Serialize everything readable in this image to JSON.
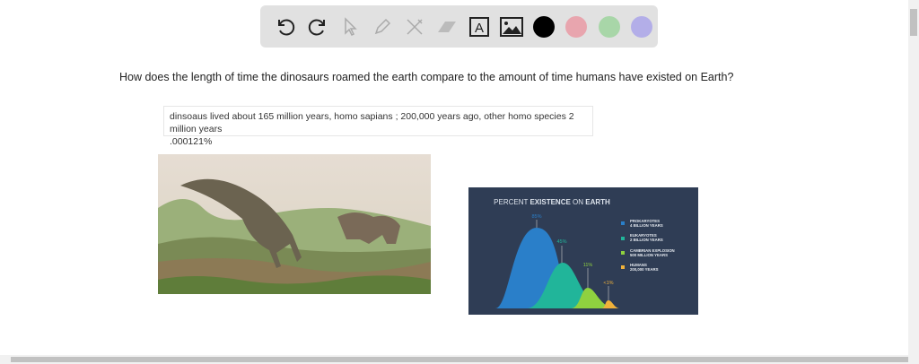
{
  "toolbar": {
    "tools": [
      "undo-icon",
      "redo-icon",
      "select-icon",
      "pen-icon",
      "tools-icon",
      "eraser-icon",
      "text-icon",
      "image-icon"
    ],
    "colors": [
      "#000000",
      "#e8a5ae",
      "#a8d6a8",
      "#b3aee8"
    ]
  },
  "question": "How does the length of time the dinosaurs roamed the earth compare to the amount of time humans have existed on Earth?",
  "answer": {
    "line1": "dinsoaus lived about 165 million years, homo sapians ; 200,000 years ago, other homo species 2 million years",
    "line2": ".000121%"
  },
  "infographic": {
    "title_a": "PERCENT ",
    "title_b": "EXISTENCE",
    "title_c": " ON ",
    "title_d": "EARTH",
    "peaks": [
      {
        "label": "85%",
        "color": "#2a7fc9"
      },
      {
        "label": "45%",
        "color": "#21b59a"
      },
      {
        "label": "11%",
        "color": "#8fd13f"
      },
      {
        "label": "<1%",
        "color": "#f0b13a"
      }
    ],
    "legend": [
      {
        "name": "PROKARYOTES",
        "sub": "4 BILLION YEARS",
        "color": "#2a7fc9"
      },
      {
        "name": "EUKARYOTES",
        "sub": "2 BILLION YEARS",
        "color": "#21b59a"
      },
      {
        "name": "CAMBRIAN EXPLOSION",
        "sub": "500 MILLION YEARS",
        "color": "#8fd13f"
      },
      {
        "name": "HUMANS",
        "sub": "200,000 YEARS",
        "color": "#f0b13a"
      }
    ]
  }
}
